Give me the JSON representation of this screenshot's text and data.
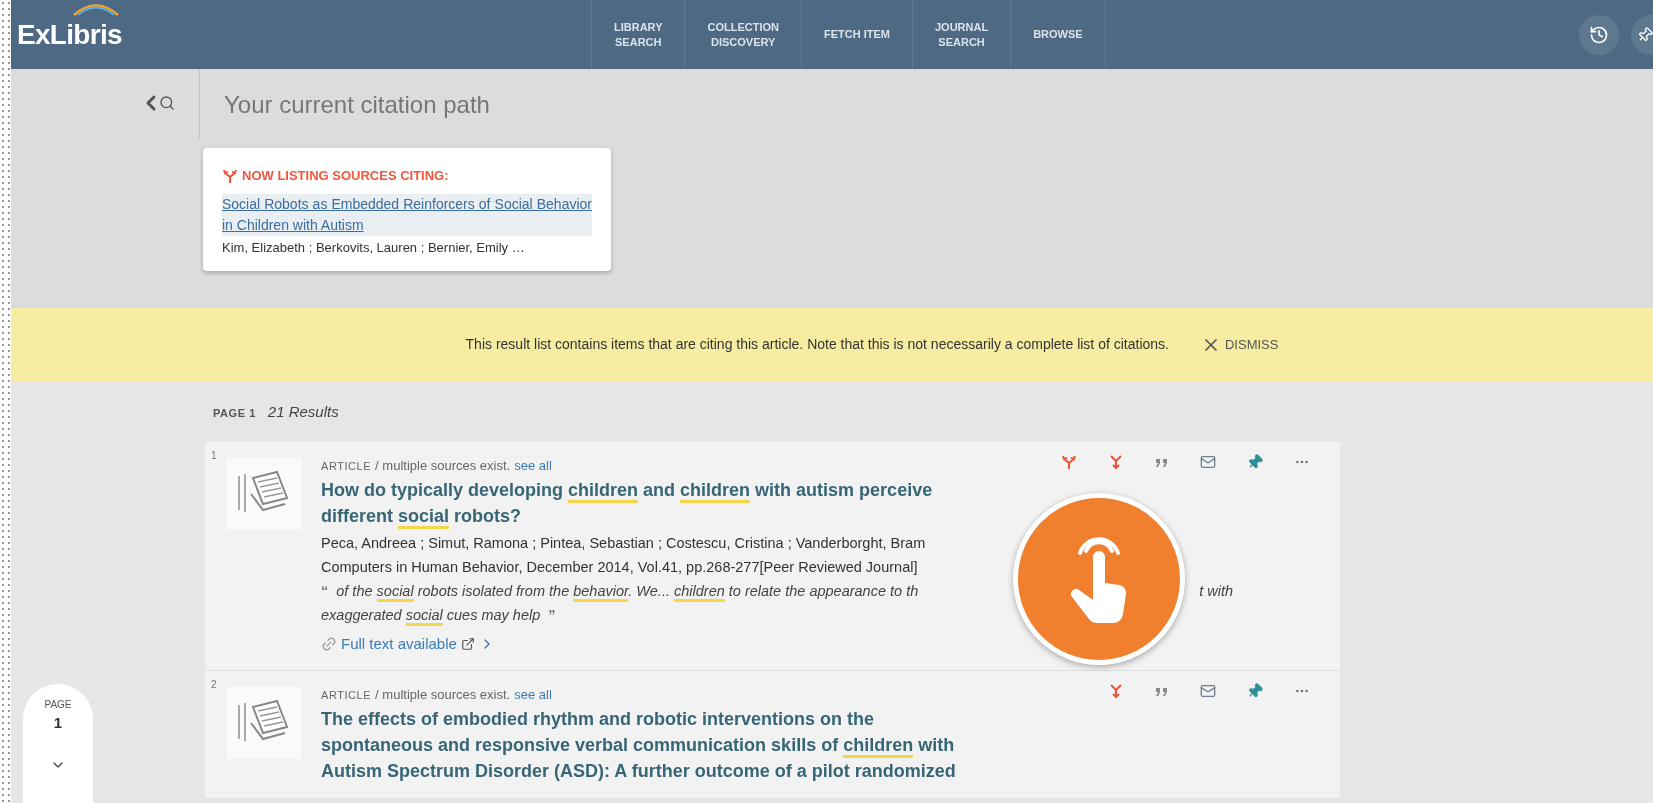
{
  "header": {
    "logo": "ExLibris",
    "nav": [
      {
        "lines": [
          "LIBRARY",
          "SEARCH"
        ]
      },
      {
        "lines": [
          "COLLECTION",
          "DISCOVERY"
        ]
      },
      {
        "lines": [
          "FETCH ITEM"
        ]
      },
      {
        "lines": [
          "JOURNAL",
          "SEARCH"
        ]
      },
      {
        "lines": [
          "BROWSE"
        ]
      }
    ]
  },
  "citation_path": {
    "title": "Your current citation path",
    "card": {
      "heading": "NOW LISTING SOURCES CITING:",
      "article_title": "Social Robots as Embedded Reinforcers of Social Behavior in Children with Autism",
      "authors": "Kim, Elizabeth ; Berkovits, Lauren ; Bernier, Emily …"
    }
  },
  "banner": {
    "text": "This result list contains items that are citing this article. Note that this is not necessarily a complete list of citations.",
    "dismiss": "DISMISS"
  },
  "results_header": {
    "page": "PAGE 1",
    "count": "21 Results"
  },
  "results": [
    {
      "number": "1",
      "type": "ARTICLE",
      "sources": "/ multiple sources exist.",
      "see_all": "see all",
      "title": [
        {
          "t": "How do typically developing ",
          "hit": false
        },
        {
          "t": "children",
          "hit": true
        },
        {
          "t": " and ",
          "hit": false
        },
        {
          "t": "children",
          "hit": true
        },
        {
          "t": " with autism perceive different ",
          "hit": false
        },
        {
          "t": "social",
          "hit": true
        },
        {
          "t": " robots?",
          "hit": false
        }
      ],
      "authors": "Peca, Andreea ; Simut, Ramona ; Pintea, Sebastian ; Costescu, Cristina ; Vanderborght, Bram",
      "source": "Computers in Human Behavior, December 2014, Vol.41, pp.268-277[Peer Reviewed Journal]",
      "snippet_before": [
        {
          "t": "of the ",
          "hit": false
        },
        {
          "t": "social",
          "hit": true
        },
        {
          "t": " robots isolated from the ",
          "hit": false
        },
        {
          "t": "behavior",
          "hit": true
        },
        {
          "t": ". We... ",
          "hit": false
        },
        {
          "t": "children",
          "hit": true
        },
        {
          "t": " to relate the appearance to th",
          "hit": false
        }
      ],
      "snippet_after": "t with",
      "quote_open": "“",
      "quote_close": "”",
      "snippet_line2": [
        {
          "t": "exaggerated ",
          "hit": false
        },
        {
          "t": "social",
          "hit": true
        },
        {
          "t": " cues may help",
          "hit": false
        }
      ],
      "full_text": "Full text available",
      "actions": [
        {
          "kind": "cited-by"
        },
        {
          "kind": "citing"
        },
        {
          "kind": "cite"
        },
        {
          "kind": "email"
        },
        {
          "kind": "pin"
        },
        {
          "kind": "more"
        }
      ]
    },
    {
      "number": "2",
      "type": "ARTICLE",
      "sources": "/ multiple sources exist.",
      "see_all": "see all",
      "title": [
        {
          "t": "The effects of embodied rhythm and robotic interventions on the spontaneous and responsive verbal communication skills of ",
          "hit": false
        },
        {
          "t": "children",
          "hit": true
        },
        {
          "t": " with Autism Spectrum Disorder (ASD): A further outcome of a pilot randomized",
          "hit": false
        }
      ],
      "actions": [
        {
          "kind": "citing"
        },
        {
          "kind": "cite"
        },
        {
          "kind": "email"
        },
        {
          "kind": "pin"
        },
        {
          "kind": "more"
        }
      ]
    }
  ],
  "page_indicator": {
    "label": "PAGE",
    "number": "1"
  }
}
